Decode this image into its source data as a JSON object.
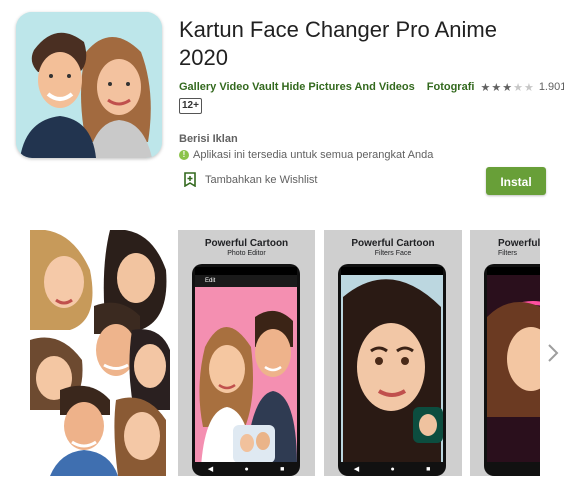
{
  "app": {
    "title_line1": "Kartun Face Changer Pro Anime",
    "title_line2": "2020",
    "developer": "Gallery Video Vault Hide Pictures And Videos",
    "category": "Fotografi",
    "rating_stars": 3,
    "rating_count": "1.901",
    "content_rating": "12+",
    "ads_notice": "Berisi Iklan",
    "availability": "Aplikasi ini tersedia untuk semua perangkat Anda",
    "wishlist_label": "Tambahkan ke Wishlist",
    "install_label": "Instal"
  },
  "screenshots": [
    {
      "heading": "",
      "subheading": ""
    },
    {
      "heading": "Powerful Cartoon",
      "subheading": "Photo Editor",
      "screen_title": "Edit"
    },
    {
      "heading": "Powerful Cartoon",
      "subheading": "Filters Face"
    },
    {
      "heading": "Powerful",
      "subheading": "Filters"
    }
  ],
  "icons": [
    "person-icon",
    "info-icon",
    "bookmark-icon",
    "chevron-right-icon"
  ],
  "colors": {
    "developer": "#33691e",
    "install": "#689f38",
    "pink_bg": "#f48fb1"
  }
}
